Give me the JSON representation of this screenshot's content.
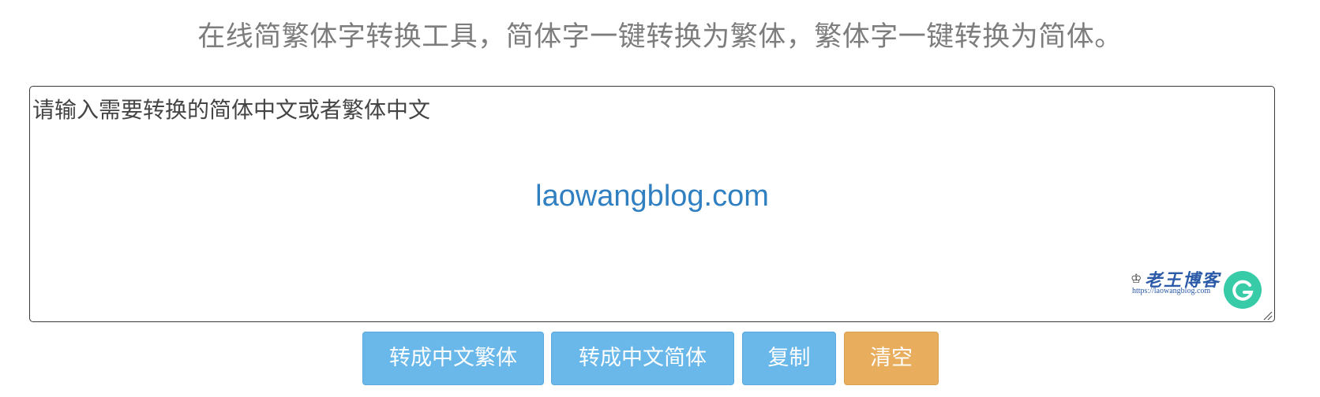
{
  "header": {
    "title": "在线简繁体字转换工具，简体字一键转换为繁体，繁体字一键转换为简体。"
  },
  "editor": {
    "text": "请输入需要转换的简体中文或者繁体中文",
    "watermark": "laowangblog.com",
    "logo_title": "老王博客",
    "logo_url": "https://laowangblog.com"
  },
  "buttons": {
    "to_traditional": "转成中文繁体",
    "to_simplified": "转成中文简体",
    "copy": "复制",
    "clear": "清空"
  },
  "colors": {
    "button_blue": "#6ab7ea",
    "button_orange": "#e8ae5e",
    "watermark": "#2f7fc1",
    "grammarly": "#15c39a"
  },
  "icons": {
    "logo": "crown-icon",
    "grammarly": "grammarly-icon",
    "resize": "resize-handle-icon"
  }
}
